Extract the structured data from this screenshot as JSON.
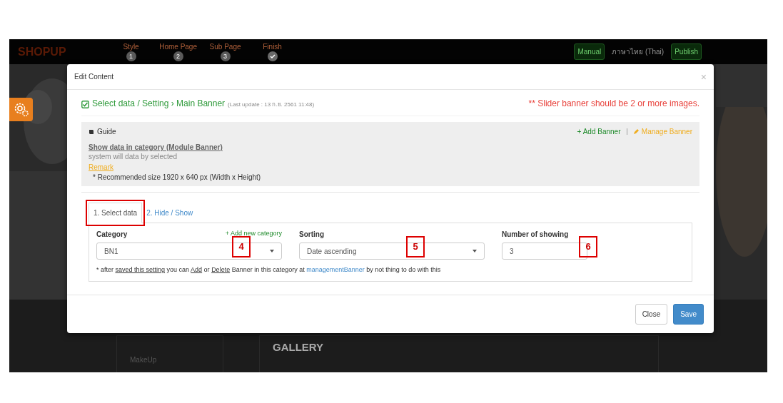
{
  "site": {
    "logo": "SHOPUP",
    "steps": [
      {
        "label": "Style",
        "number": "1",
        "done": false
      },
      {
        "label": "Home Page",
        "number": "2",
        "done": false
      },
      {
        "label": "Sub Page",
        "number": "3",
        "done": false
      },
      {
        "label": "Finish",
        "done": true
      }
    ],
    "manual": "Manual",
    "language": "ภาษาไทย (Thai)",
    "publish": "Publish",
    "gallery": "GALLERY",
    "side_item": "MakeUp"
  },
  "modal": {
    "title": "Edit Content",
    "close": "×",
    "heading": {
      "text": "Select data / Setting › Main Banner",
      "note": "(Last update : 13 ก.ย. 2561 11:48)"
    },
    "warning": "** Slider banner should be 2 or more images.",
    "guide": {
      "title": "Guide",
      "add": "+ Add Banner",
      "separator": "|",
      "manage": "Manage Banner",
      "subtitle": "Show data in category (Module Banner)",
      "description": "system will data by selected",
      "remark": "Remark",
      "size": "* Recommended size 1920 x 640 px (Width x Height)"
    },
    "tabs": [
      {
        "label": "1. Select data",
        "selected": true
      },
      {
        "label": "2. Hide / Show",
        "selected": false
      }
    ],
    "fields": [
      {
        "label": "Category",
        "link": "+ Add new category",
        "value": "BN1",
        "kind": "select"
      },
      {
        "label": "Sorting",
        "value": "Date ascending",
        "kind": "select"
      },
      {
        "label": "Number of showing",
        "value": "3",
        "kind": "number"
      }
    ],
    "footnote": [
      {
        "text": "* after ",
        "kind": "plain"
      },
      {
        "text": "saved this setting",
        "kind": "underline"
      },
      {
        "text": " you can ",
        "kind": "plain"
      },
      {
        "text": "Add",
        "kind": "underline"
      },
      {
        "text": " or ",
        "kind": "plain"
      },
      {
        "text": "Delete",
        "kind": "underline"
      },
      {
        "text": " Banner in this category at ",
        "kind": "plain"
      },
      {
        "text": "managementBanner",
        "kind": "link"
      },
      {
        "text": " by not thing to do with this",
        "kind": "plain"
      }
    ],
    "buttons": [
      {
        "label": "Close",
        "kind": "secondary"
      },
      {
        "label": "Save",
        "kind": "primary"
      }
    ]
  },
  "annotations": [
    {
      "label": "4"
    },
    {
      "label": "5"
    },
    {
      "label": "6"
    }
  ]
}
